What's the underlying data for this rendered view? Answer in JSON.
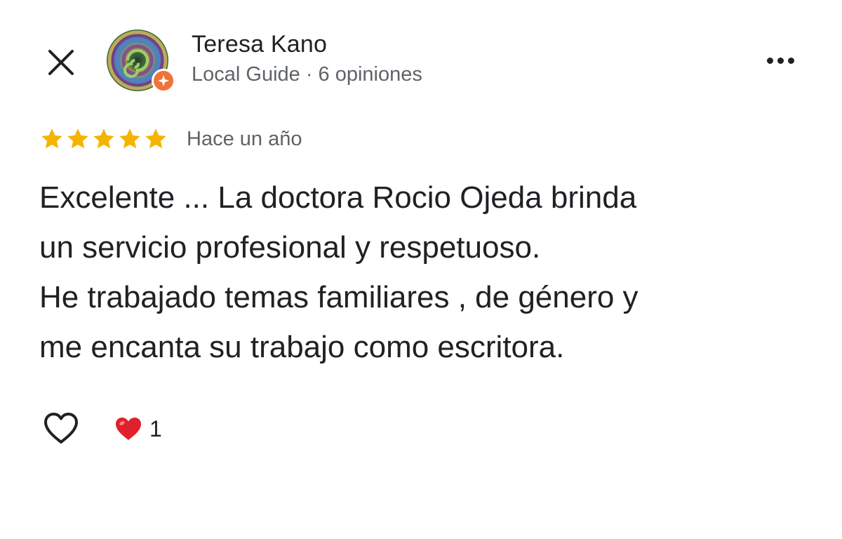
{
  "header": {
    "close_icon": "close-icon",
    "more_icon": "more-horizontal-icon",
    "author": {
      "name": "Teresa Kano",
      "meta": "Local Guide · 6 opiniones",
      "badge_icon": "local-guide-star-icon"
    }
  },
  "review": {
    "rating": 5,
    "rating_max": 5,
    "star_color": "#F4B400",
    "time": "Hace un año",
    "text": "Excelente ... La doctora Rocio Ojeda brinda\nun servicio profesional y respetuoso.\nHe trabajado temas familiares , de género y\nme encanta su trabajo como escritora."
  },
  "actions": {
    "like_icon": "heart-outline-icon",
    "reaction_icon": "red-heart-icon",
    "reaction_color": "#E0202B",
    "reaction_count": "1"
  }
}
